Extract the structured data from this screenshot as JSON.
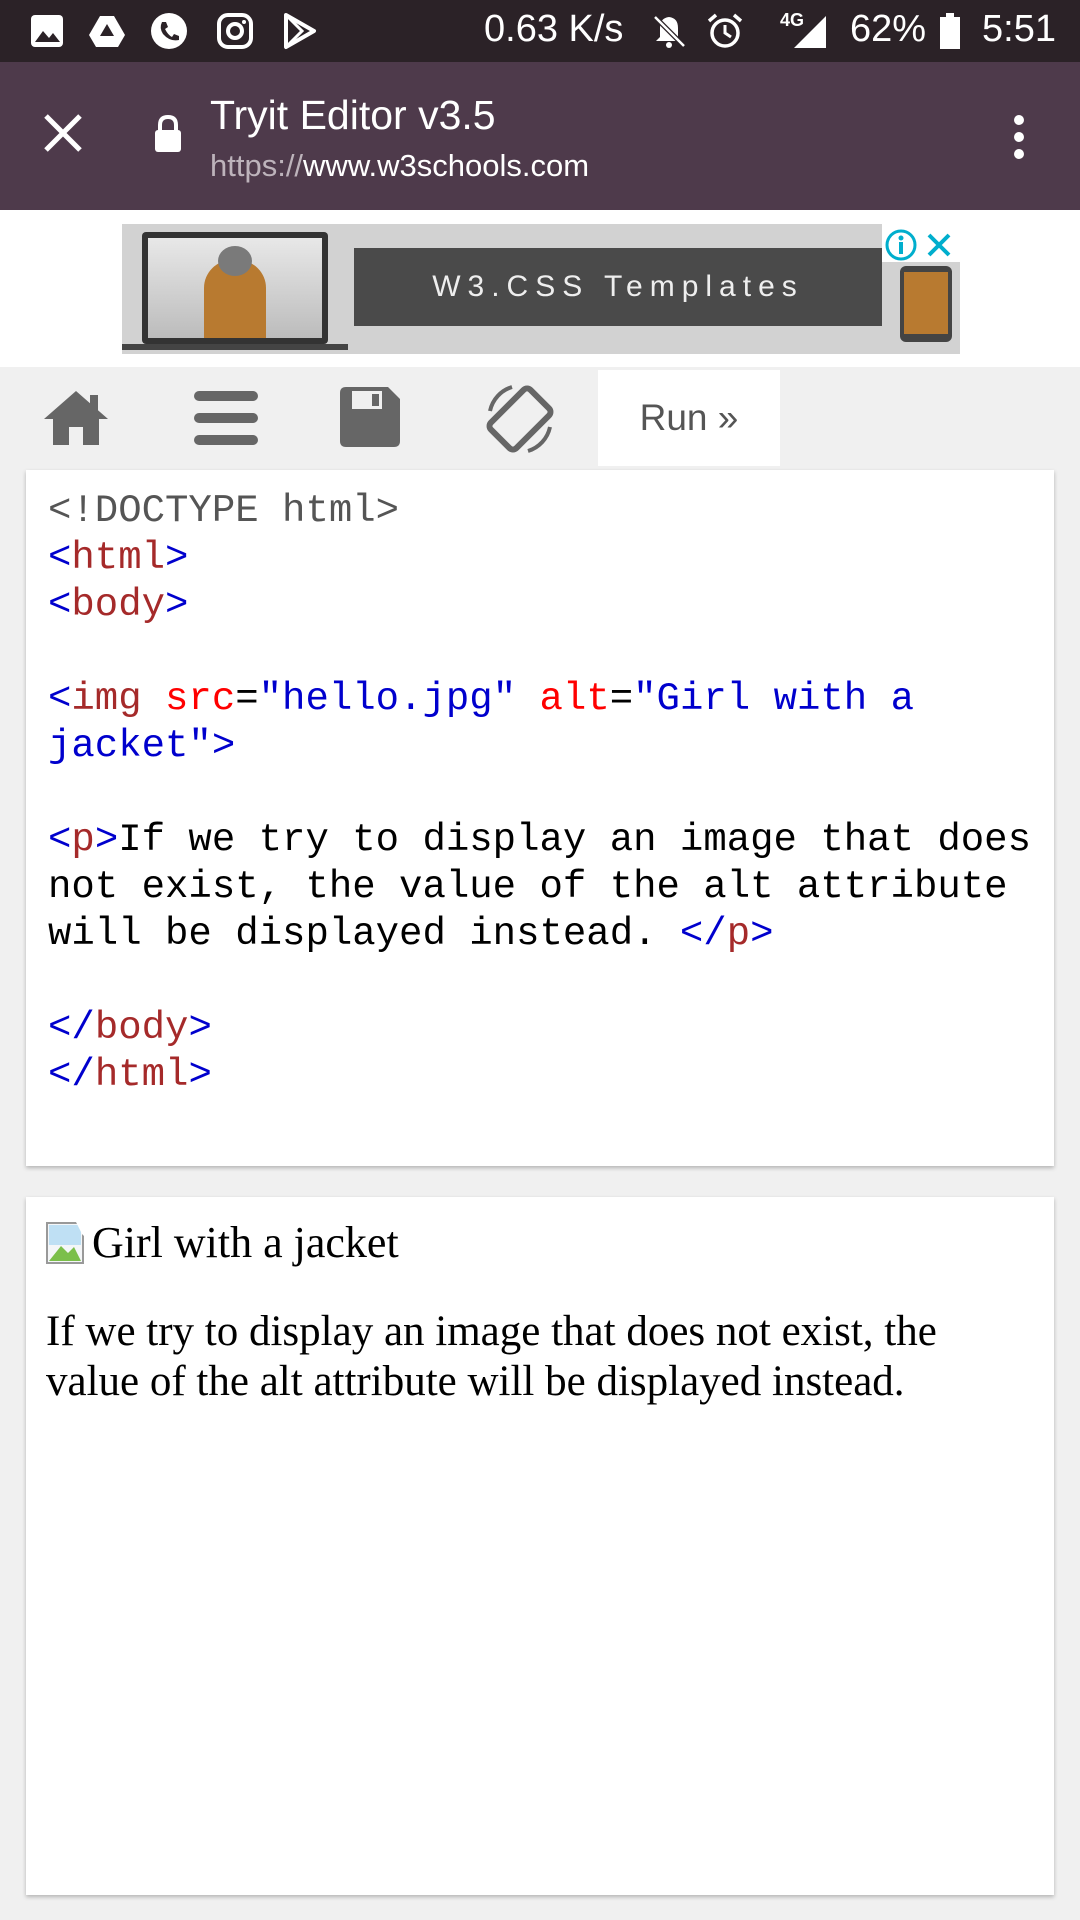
{
  "status_bar": {
    "speed": "0.63 K/s",
    "network": "4G",
    "battery": "62%",
    "time": "5:51"
  },
  "browser": {
    "title": "Tryit Editor v3.5",
    "url_scheme": "https://",
    "url_host": "www.w3schools.com"
  },
  "ad": {
    "text": "W3.CSS Templates"
  },
  "toolbar": {
    "run_label": "Run »"
  },
  "code": {
    "l1": "<!DOCTYPE html>",
    "html_open_lt": "<",
    "html_open_name": "html",
    "html_open_gt": ">",
    "body_open_lt": "<",
    "body_open_name": "body",
    "body_open_gt": ">",
    "img_lt": "<",
    "img_name": "img",
    "img_src_attr": "src",
    "eq": "=",
    "img_src_val": "\"hello.jpg\"",
    "img_alt_attr": "alt",
    "img_alt_val": "\"Girl with a jacket\"",
    "img_gt": ">",
    "p_open_lt": "<",
    "p_open_name": "p",
    "p_open_gt": ">",
    "p_text": "If we try to display an image that does not exist, the value of the alt attribute will be displayed instead. ",
    "p_close_lt": "</",
    "p_close_name": "p",
    "p_close_gt": ">",
    "body_close_lt": "</",
    "body_close_name": "body",
    "body_close_gt": ">",
    "html_close_lt": "</",
    "html_close_name": "html",
    "html_close_gt": ">"
  },
  "result": {
    "alt_text": "Girl with a jacket",
    "paragraph": "If we try to display an image that does not exist, the value of the alt attribute will be displayed instead."
  }
}
